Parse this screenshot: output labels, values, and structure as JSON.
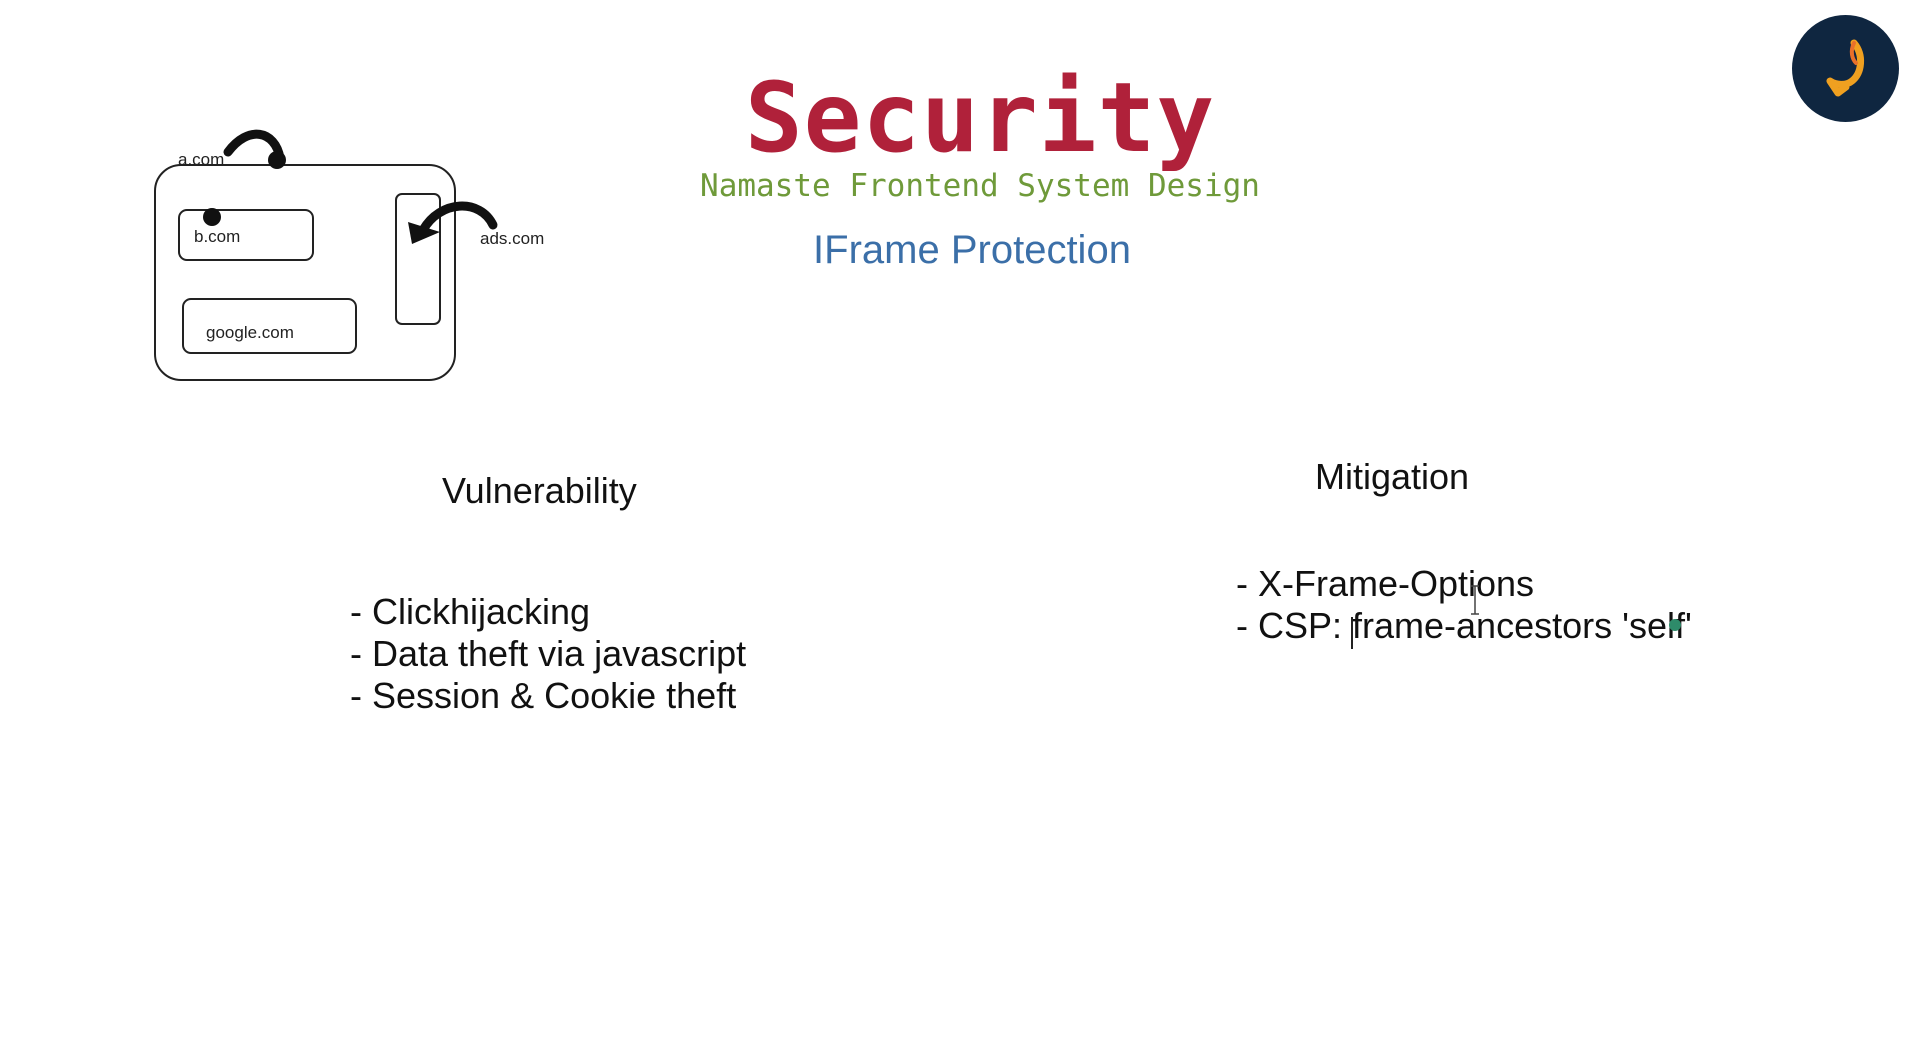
{
  "slide": {
    "title": "Security",
    "subtitle": "Namaste Frontend System Design",
    "topic": "IFrame Protection"
  },
  "diagram": {
    "labels": {
      "parent": "a.com",
      "frame_b": "b.com",
      "frame_ads": "ads.com",
      "frame_google": "google.com"
    }
  },
  "vulnerability": {
    "heading": "Vulnerability",
    "items": [
      "- Clickhijacking",
      "- Data theft via javascript",
      "- Session & Cookie theft"
    ]
  },
  "mitigation": {
    "heading": "Mitigation",
    "items": [
      "- X-Frame-Options",
      "- CSP: frame-ancestors 'self'"
    ]
  },
  "colors": {
    "title": "#b0213a",
    "subtitle": "#6f9a3a",
    "topic": "#3b6fa8",
    "logo_bg": "#0f2640",
    "logo_flame": "#f0a020"
  },
  "icons": {
    "logo": "flame-logo-icon",
    "cursor": "ibeam-cursor-icon",
    "pointer": "pointer-dot-icon"
  }
}
